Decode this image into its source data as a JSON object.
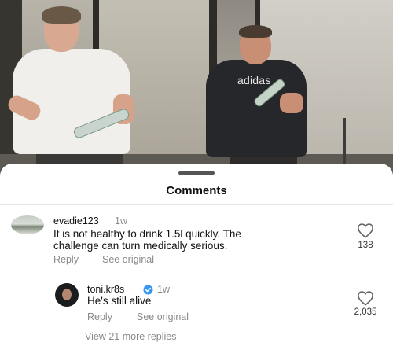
{
  "video": {
    "shirt_logo": "adidas"
  },
  "comments_sheet": {
    "title": "Comments"
  },
  "comment": {
    "username": "evadie123",
    "time": "1w",
    "text_line1": "It is not healthy to drink 1.5l quickly. The",
    "text_line2": "challenge can turn medically serious.",
    "reply_label": "Reply",
    "see_original_label": "See original",
    "like_count": "138"
  },
  "reply": {
    "username": "toni.kr8s",
    "time": "1w",
    "text": "He's still alive",
    "reply_label": "Reply",
    "see_original_label": "See original",
    "like_count": "2,035"
  },
  "view_more_replies": "View 21 more replies",
  "icons": {
    "heart": "heart-icon",
    "verified": "verified-badge-icon"
  },
  "colors": {
    "verified_blue": "#3897f0",
    "secondary_text": "#8a8a8a"
  }
}
